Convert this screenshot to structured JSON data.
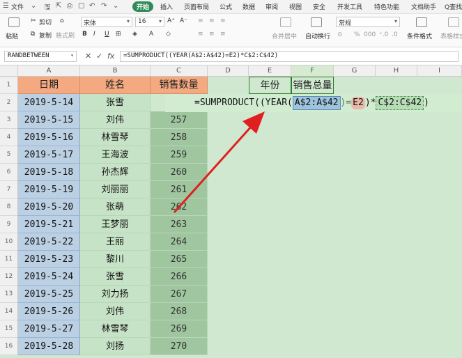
{
  "menubar": {
    "file": "文件",
    "tabs": [
      "开始",
      "插入",
      "页面布局",
      "公式",
      "数据",
      "审阅",
      "视图",
      "安全",
      "开发工具",
      "特色功能",
      "文档助手"
    ],
    "active_tab": "开始",
    "search": "Q查找"
  },
  "ribbon": {
    "paste": "粘贴",
    "cut": "剪切",
    "copy": "复制",
    "format_painter": "格式刷",
    "font_name": "宋体",
    "font_size": "16",
    "bold": "B",
    "italic": "I",
    "underline": "U",
    "grow": "A⁺",
    "shrink": "A⁻",
    "merge_center": "合并居中",
    "wrap_text": "自动换行",
    "number_format": "常规",
    "percent": "%",
    "thousands": "000",
    "conditional_format": "条件格式",
    "table_style": "表格样式"
  },
  "formula_bar": {
    "name_box": "RANDBETWEEN",
    "cancel": "✕",
    "confirm": "✓",
    "fx": "fx",
    "formula": "=SUMPRODUCT((YEAR(A$2:A$42)=E2)*C$2:C$42)"
  },
  "columns": [
    "A",
    "B",
    "C",
    "D",
    "E",
    "F",
    "G",
    "H",
    "I"
  ],
  "headers": {
    "A": "日期",
    "B": "姓名",
    "C": "销售数量",
    "E": "年份",
    "F": "销售总量"
  },
  "rows": [
    {
      "n": "1"
    },
    {
      "n": "2",
      "date": "2019-5-14",
      "name": "张雪",
      "qty": ""
    },
    {
      "n": "3",
      "date": "2019-5-15",
      "name": "刘伟",
      "qty": "257"
    },
    {
      "n": "4",
      "date": "2019-5-16",
      "name": "林雪琴",
      "qty": "258"
    },
    {
      "n": "5",
      "date": "2019-5-17",
      "name": "王海波",
      "qty": "259"
    },
    {
      "n": "6",
      "date": "2019-5-18",
      "name": "孙杰辉",
      "qty": "260"
    },
    {
      "n": "7",
      "date": "2019-5-19",
      "name": "刘丽丽",
      "qty": "261"
    },
    {
      "n": "8",
      "date": "2019-5-20",
      "name": "张萌",
      "qty": "262"
    },
    {
      "n": "9",
      "date": "2019-5-21",
      "name": "王梦丽",
      "qty": "263"
    },
    {
      "n": "10",
      "date": "2019-5-22",
      "name": "王丽",
      "qty": "264"
    },
    {
      "n": "11",
      "date": "2019-5-23",
      "name": "黎川",
      "qty": "265"
    },
    {
      "n": "12",
      "date": "2019-5-24",
      "name": "张雪",
      "qty": "266"
    },
    {
      "n": "13",
      "date": "2019-5-25",
      "name": "刘力扬",
      "qty": "267"
    },
    {
      "n": "14",
      "date": "2019-5-26",
      "name": "刘伟",
      "qty": "268"
    },
    {
      "n": "15",
      "date": "2019-5-27",
      "name": "林雪琴",
      "qty": "269"
    },
    {
      "n": "16",
      "date": "2019-5-28",
      "name": "刘扬",
      "qty": "270"
    }
  ],
  "cell_formula_parts": [
    "=SUMPRODUCT((YEAR(",
    "A$2:A$42",
    ")=",
    "E2",
    ")*",
    "C$2:C$42",
    ")"
  ],
  "annotation": {
    "arrow_color": "#e02020"
  }
}
